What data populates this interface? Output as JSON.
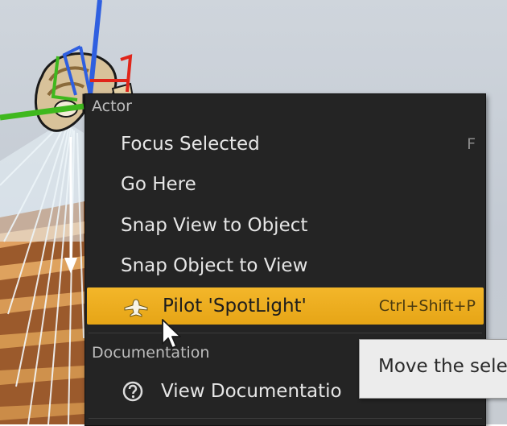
{
  "context_menu": {
    "sections": {
      "actor_header": "Actor",
      "documentation_header": "Documentation"
    },
    "items": [
      {
        "label": "Focus Selected",
        "shortcut": "F"
      },
      {
        "label": "Go Here",
        "shortcut": ""
      },
      {
        "label": "Snap View to Object",
        "shortcut": ""
      },
      {
        "label": "Snap Object to View",
        "shortcut": ""
      },
      {
        "label": "Pilot 'SpotLight'",
        "shortcut": "Ctrl+Shift+P",
        "highlighted": true,
        "icon": "pilot-icon"
      },
      {
        "label": "View Documentatio",
        "shortcut": "",
        "icon": "help-icon"
      }
    ]
  },
  "tooltip": {
    "text": "Move the sele"
  },
  "colors": {
    "menu_bg": "#242424",
    "highlight": "#f0b020",
    "tooltip_bg": "#ececec",
    "gizmo_x": "#e0251a",
    "gizmo_y": "#3fb81e",
    "gizmo_z": "#2f5fe0"
  }
}
